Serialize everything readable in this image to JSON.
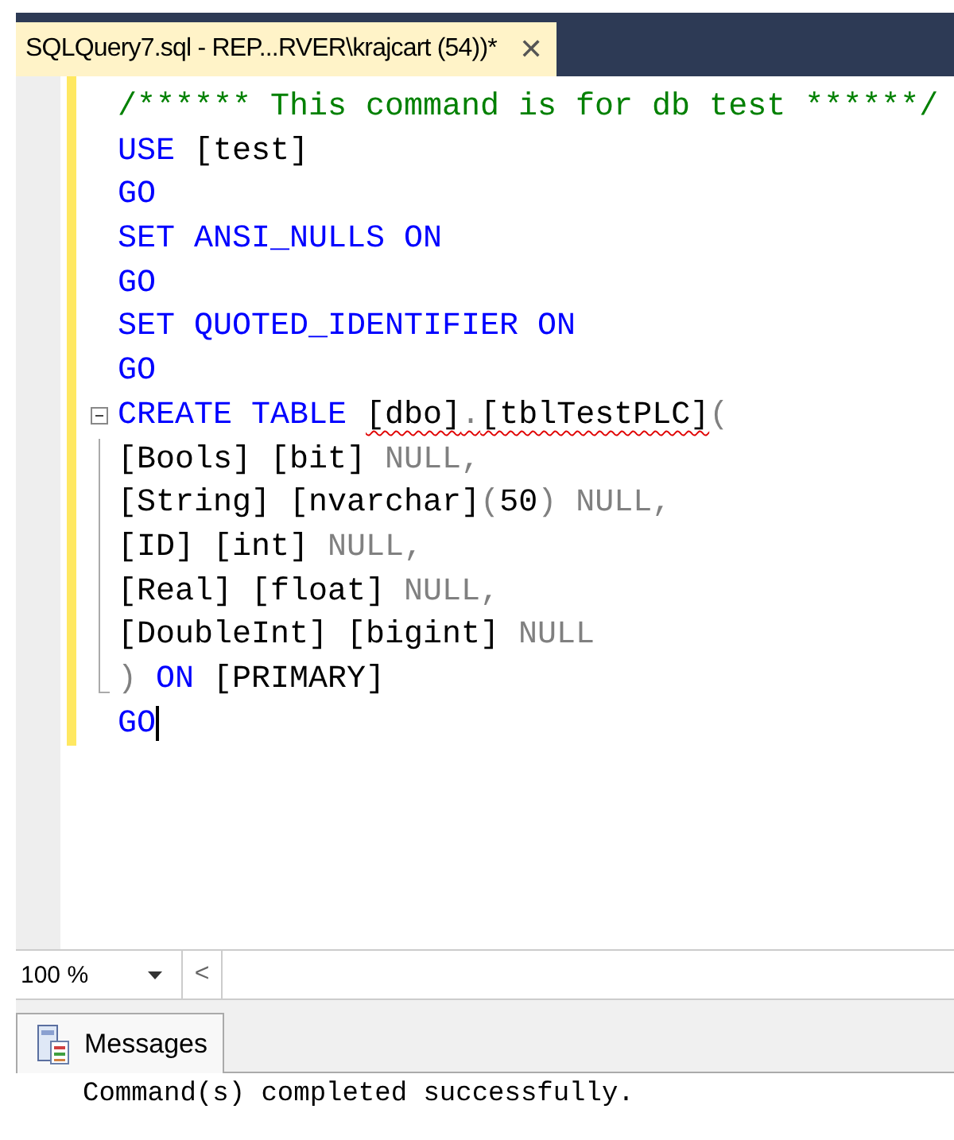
{
  "tab": {
    "title": "SQLQuery7.sql - REP...RVER\\krajcart (54))*",
    "close": "✕",
    "selected": true
  },
  "editor": {
    "lines": [
      {
        "tokens": [
          {
            "kind": "comment",
            "text": "/****** This command is for db test ******/"
          }
        ]
      },
      {
        "tokens": [
          {
            "kind": "keyword",
            "text": "USE"
          },
          {
            "kind": "plain",
            "text": " [test]"
          }
        ]
      },
      {
        "tokens": [
          {
            "kind": "keyword",
            "text": "GO"
          }
        ]
      },
      {
        "tokens": [
          {
            "kind": "keyword",
            "text": "SET ANSI_NULLS ON"
          }
        ]
      },
      {
        "tokens": [
          {
            "kind": "keyword",
            "text": "GO"
          }
        ]
      },
      {
        "tokens": [
          {
            "kind": "keyword",
            "text": "SET QUOTED_IDENTIFIER ON"
          }
        ]
      },
      {
        "tokens": [
          {
            "kind": "keyword",
            "text": "GO"
          }
        ]
      },
      {
        "expanded": true,
        "tokens": [
          {
            "kind": "keyword",
            "text": "CREATE TABLE "
          },
          {
            "kind": "plain",
            "text": "[dbo]",
            "squiggle": true
          },
          {
            "kind": "gray",
            "text": ".",
            "squiggle": true
          },
          {
            "kind": "plain",
            "text": "[tblTestPLC]",
            "squiggle": true
          },
          {
            "kind": "gray",
            "text": "("
          }
        ],
        "children": [
          {
            "tokens": [
              {
                "kind": "plain",
                "text": "[Bools] [bit] "
              },
              {
                "kind": "gray",
                "text": "NULL,"
              }
            ]
          },
          {
            "tokens": [
              {
                "kind": "plain",
                "text": "[String] [nvarchar]"
              },
              {
                "kind": "gray",
                "text": "("
              },
              {
                "kind": "plain",
                "text": "50"
              },
              {
                "kind": "gray",
                "text": ") NULL,"
              }
            ]
          },
          {
            "tokens": [
              {
                "kind": "plain",
                "text": "[ID] [int] "
              },
              {
                "kind": "gray",
                "text": "NULL,"
              }
            ]
          },
          {
            "tokens": [
              {
                "kind": "plain",
                "text": "[Real] [float] "
              },
              {
                "kind": "gray",
                "text": "NULL,"
              }
            ]
          },
          {
            "tokens": [
              {
                "kind": "plain",
                "text": "[DoubleInt] [bigint] "
              },
              {
                "kind": "gray",
                "text": "NULL"
              }
            ]
          },
          {
            "tokens": [
              {
                "kind": "gray",
                "text": ") "
              },
              {
                "kind": "keyword",
                "text": "ON"
              },
              {
                "kind": "plain",
                "text": " [PRIMARY]"
              }
            ]
          }
        ]
      },
      {
        "cursor": true,
        "tokens": [
          {
            "kind": "keyword",
            "text": "GO"
          }
        ]
      }
    ]
  },
  "zoom": {
    "value": "100 %",
    "arrow": "<"
  },
  "results": {
    "tabs": [
      {
        "label": "Messages",
        "selected": true
      }
    ],
    "message": "Command(s) completed successfully."
  }
}
